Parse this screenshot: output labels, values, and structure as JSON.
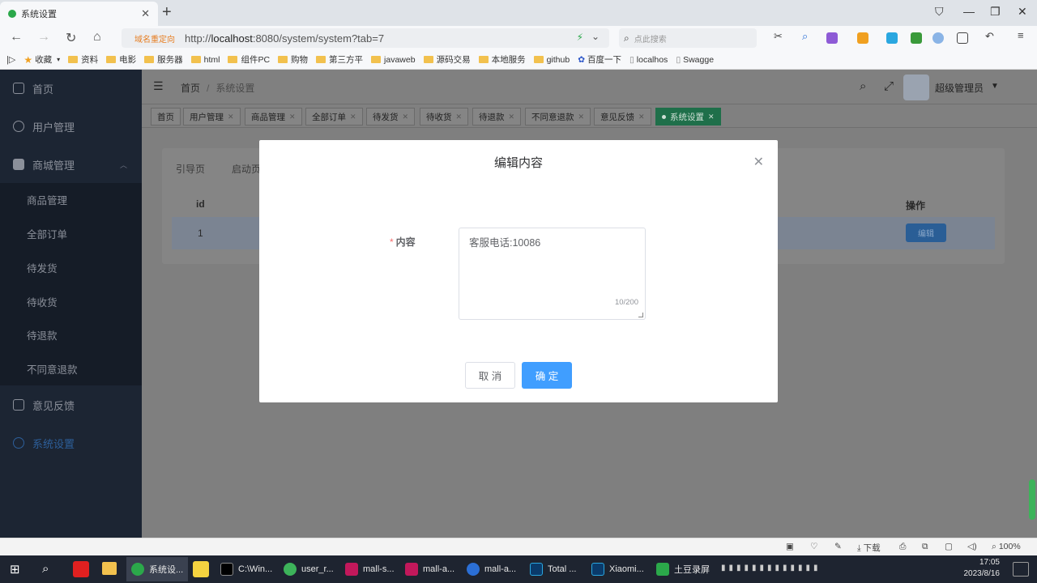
{
  "browser": {
    "tab_title": "系统设置",
    "redirect_label": "域名重定向",
    "url_prefix": "http://",
    "url_host": "localhost",
    "url_rest": ":8080/system/system?tab=7",
    "search_placeholder": "点此搜索",
    "bookmarks": [
      "收藏",
      "资料",
      "电影",
      "服务器",
      "html",
      "组件PC",
      "购物",
      "第三方平",
      "javaweb",
      "源码交易",
      "本地服务",
      "github",
      "百度一下",
      "localhos",
      "Swagge"
    ]
  },
  "header": {
    "breadcrumb_home": "首页",
    "breadcrumb_sep": "/",
    "breadcrumb_current": "系统设置",
    "user_name": "超级管理员"
  },
  "sidebar": {
    "items": [
      {
        "label": "首页"
      },
      {
        "label": "用户管理"
      },
      {
        "label": "商城管理"
      },
      {
        "label": "意见反馈"
      },
      {
        "label": "系统设置"
      }
    ],
    "submenu": [
      "商品管理",
      "全部订单",
      "待发货",
      "待收货",
      "待退款",
      "不同意退款"
    ]
  },
  "tags": [
    "首页",
    "用户管理",
    "商品管理",
    "全部订单",
    "待发货",
    "待收货",
    "待退款",
    "不同意退款",
    "意见反馈",
    "系统设置"
  ],
  "content": {
    "tabs": [
      "引导页",
      "启动页"
    ],
    "table_headers": {
      "id": "id",
      "actions": "操作"
    },
    "rows": [
      {
        "id": "1",
        "action_label": "编辑"
      }
    ]
  },
  "modal": {
    "title": "编辑内容",
    "field_required_mark": "*",
    "field_label": "内容",
    "field_value": "客服电话:10086",
    "char_count": "10/200",
    "cancel_label": "取 消",
    "confirm_label": "确 定"
  },
  "statusbar": {
    "download_label": "下载",
    "zoom": "100%"
  },
  "taskbar": {
    "apps": [
      "系统设...",
      "C:\\Win...",
      "user_r...",
      "mall-s...",
      "mall-a...",
      "mall-a...",
      "Total ...",
      "Xiaomi...",
      "土豆录屏"
    ],
    "time": "17:05",
    "date": "2023/8/16"
  },
  "colors": {
    "primary": "#409eff",
    "sidebar_bg": "#1c2533",
    "required": "#f56c6c",
    "active_tag": "#1f6f4a"
  }
}
